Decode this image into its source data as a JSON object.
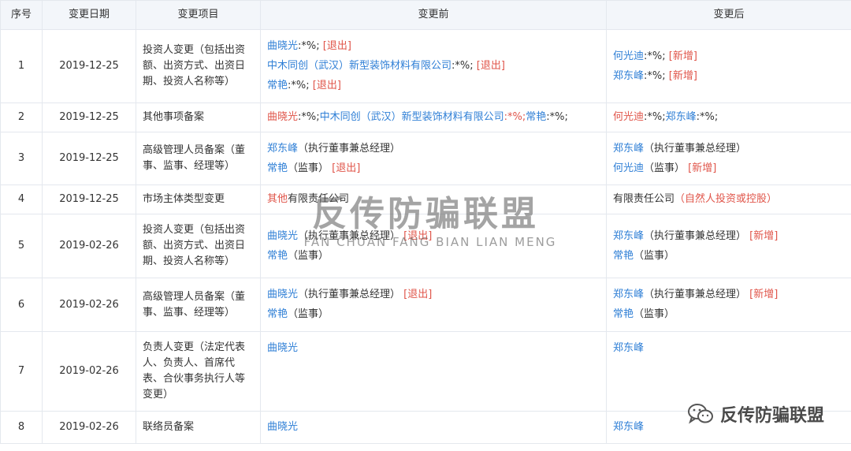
{
  "table": {
    "headers": {
      "index": "序号",
      "date": "变更日期",
      "item": "变更项目",
      "before": "变更前",
      "after": "变更后"
    },
    "rows": [
      {
        "index": "1",
        "date": "2019-12-25",
        "item": "投资人变更（包括出资额、出资方式、出资日期、投资人名称等）",
        "before": [
          [
            {
              "t": "曲晓光",
              "c": "p"
            },
            {
              "t": ":*%; ",
              "c": "k"
            },
            {
              "t": "[退出]",
              "c": "r"
            }
          ],
          [
            {
              "t": "中木同创（武汉）新型装饰材料有限公司",
              "c": "p"
            },
            {
              "t": ":*%; ",
              "c": "k"
            },
            {
              "t": "[退出]",
              "c": "r"
            }
          ],
          [
            {
              "t": "常艳",
              "c": "p"
            },
            {
              "t": ":*%; ",
              "c": "k"
            },
            {
              "t": "[退出]",
              "c": "r"
            }
          ]
        ],
        "after": [
          [
            {
              "t": "何光迪",
              "c": "p"
            },
            {
              "t": ":*%; ",
              "c": "k"
            },
            {
              "t": "[新增]",
              "c": "r"
            }
          ],
          [
            {
              "t": "郑东峰",
              "c": "p"
            },
            {
              "t": ":*%; ",
              "c": "k"
            },
            {
              "t": "[新增]",
              "c": "r"
            }
          ]
        ]
      },
      {
        "index": "2",
        "date": "2019-12-25",
        "item": "其他事项备案",
        "before": [
          [
            {
              "t": "曲晓光",
              "c": "r"
            },
            {
              "t": ":*%;",
              "c": "k"
            },
            {
              "t": "中木同创（武汉）新型装饰材料有限公司",
              "c": "p"
            },
            {
              "t": ":*%;",
              "c": "r"
            },
            {
              "t": "常艳",
              "c": "p"
            },
            {
              "t": ":*%;",
              "c": "k"
            }
          ]
        ],
        "after": [
          [
            {
              "t": "何光迪",
              "c": "r"
            },
            {
              "t": ":*%;",
              "c": "k"
            },
            {
              "t": "郑东峰",
              "c": "p"
            },
            {
              "t": ":*%;",
              "c": "k"
            }
          ]
        ]
      },
      {
        "index": "3",
        "date": "2019-12-25",
        "item": "高级管理人员备案（董事、监事、经理等）",
        "before": [
          [
            {
              "t": "郑东峰",
              "c": "p"
            },
            {
              "t": "（执行董事兼总经理）",
              "c": "k"
            }
          ],
          [
            {
              "t": "常艳",
              "c": "p"
            },
            {
              "t": "（监事）",
              "c": "k"
            },
            {
              "t": "  [退出]",
              "c": "r"
            }
          ]
        ],
        "after": [
          [
            {
              "t": "郑东峰",
              "c": "p"
            },
            {
              "t": "（执行董事兼总经理）",
              "c": "k"
            }
          ],
          [
            {
              "t": "何光迪",
              "c": "p"
            },
            {
              "t": "（监事）",
              "c": "k"
            },
            {
              "t": "  [新增]",
              "c": "r"
            }
          ]
        ]
      },
      {
        "index": "4",
        "date": "2019-12-25",
        "item": "市场主体类型变更",
        "before": [
          [
            {
              "t": "其他",
              "c": "r"
            },
            {
              "t": "有限责任公司",
              "c": "k"
            }
          ]
        ],
        "after": [
          [
            {
              "t": "有限责任公司",
              "c": "k"
            },
            {
              "t": "（自然人投资或控股）",
              "c": "r"
            }
          ]
        ]
      },
      {
        "index": "5",
        "date": "2019-02-26",
        "item": "投资人变更（包括出资额、出资方式、出资日期、投资人名称等）",
        "before": [
          [
            {
              "t": "曲晓光",
              "c": "p"
            },
            {
              "t": "（执行董事兼总经理）",
              "c": "k"
            },
            {
              "t": "  [退出]",
              "c": "r"
            }
          ],
          [
            {
              "t": "常艳",
              "c": "p"
            },
            {
              "t": "（监事）",
              "c": "k"
            }
          ]
        ],
        "after": [
          [
            {
              "t": "郑东峰",
              "c": "p"
            },
            {
              "t": "（执行董事兼总经理）",
              "c": "k"
            },
            {
              "t": "  [新增]",
              "c": "r"
            }
          ],
          [
            {
              "t": "常艳",
              "c": "p"
            },
            {
              "t": "（监事）",
              "c": "k"
            }
          ]
        ]
      },
      {
        "index": "6",
        "date": "2019-02-26",
        "item": "高级管理人员备案（董事、监事、经理等）",
        "before": [
          [
            {
              "t": "曲晓光",
              "c": "p"
            },
            {
              "t": "（执行董事兼总经理）",
              "c": "k"
            },
            {
              "t": "  [退出]",
              "c": "r"
            }
          ],
          [
            {
              "t": "常艳",
              "c": "p"
            },
            {
              "t": "（监事）",
              "c": "k"
            }
          ]
        ],
        "after": [
          [
            {
              "t": "郑东峰",
              "c": "p"
            },
            {
              "t": "（执行董事兼总经理）",
              "c": "k"
            },
            {
              "t": "  [新增]",
              "c": "r"
            }
          ],
          [
            {
              "t": "常艳",
              "c": "p"
            },
            {
              "t": "（监事）",
              "c": "k"
            }
          ]
        ]
      },
      {
        "index": "7",
        "date": "2019-02-26",
        "item": "负责人变更（法定代表人、负责人、首席代表、合伙事务执行人等变更）",
        "before": [
          [
            {
              "t": "曲晓光",
              "c": "p"
            }
          ]
        ],
        "after": [
          [
            {
              "t": "郑东峰",
              "c": "p"
            }
          ]
        ],
        "top_aligned": true
      },
      {
        "index": "8",
        "date": "2019-02-26",
        "item": "联络员备案",
        "before": [
          [
            {
              "t": "曲晓光",
              "c": "p"
            }
          ]
        ],
        "after": [
          [
            {
              "t": "郑东峰",
              "c": "p"
            }
          ]
        ]
      }
    ]
  },
  "watermark": {
    "main": "反传防骗联盟",
    "sub": "FAN CHUAN FANG BIAN LIAN MENG"
  },
  "account": {
    "icon": "wechat-icon",
    "name": "反传防骗联盟"
  },
  "colors": {
    "person_link": "#2f7fd6",
    "status_red": "#e0554a",
    "header_bg": "#f3f6fa",
    "border": "#e4e8ee"
  }
}
